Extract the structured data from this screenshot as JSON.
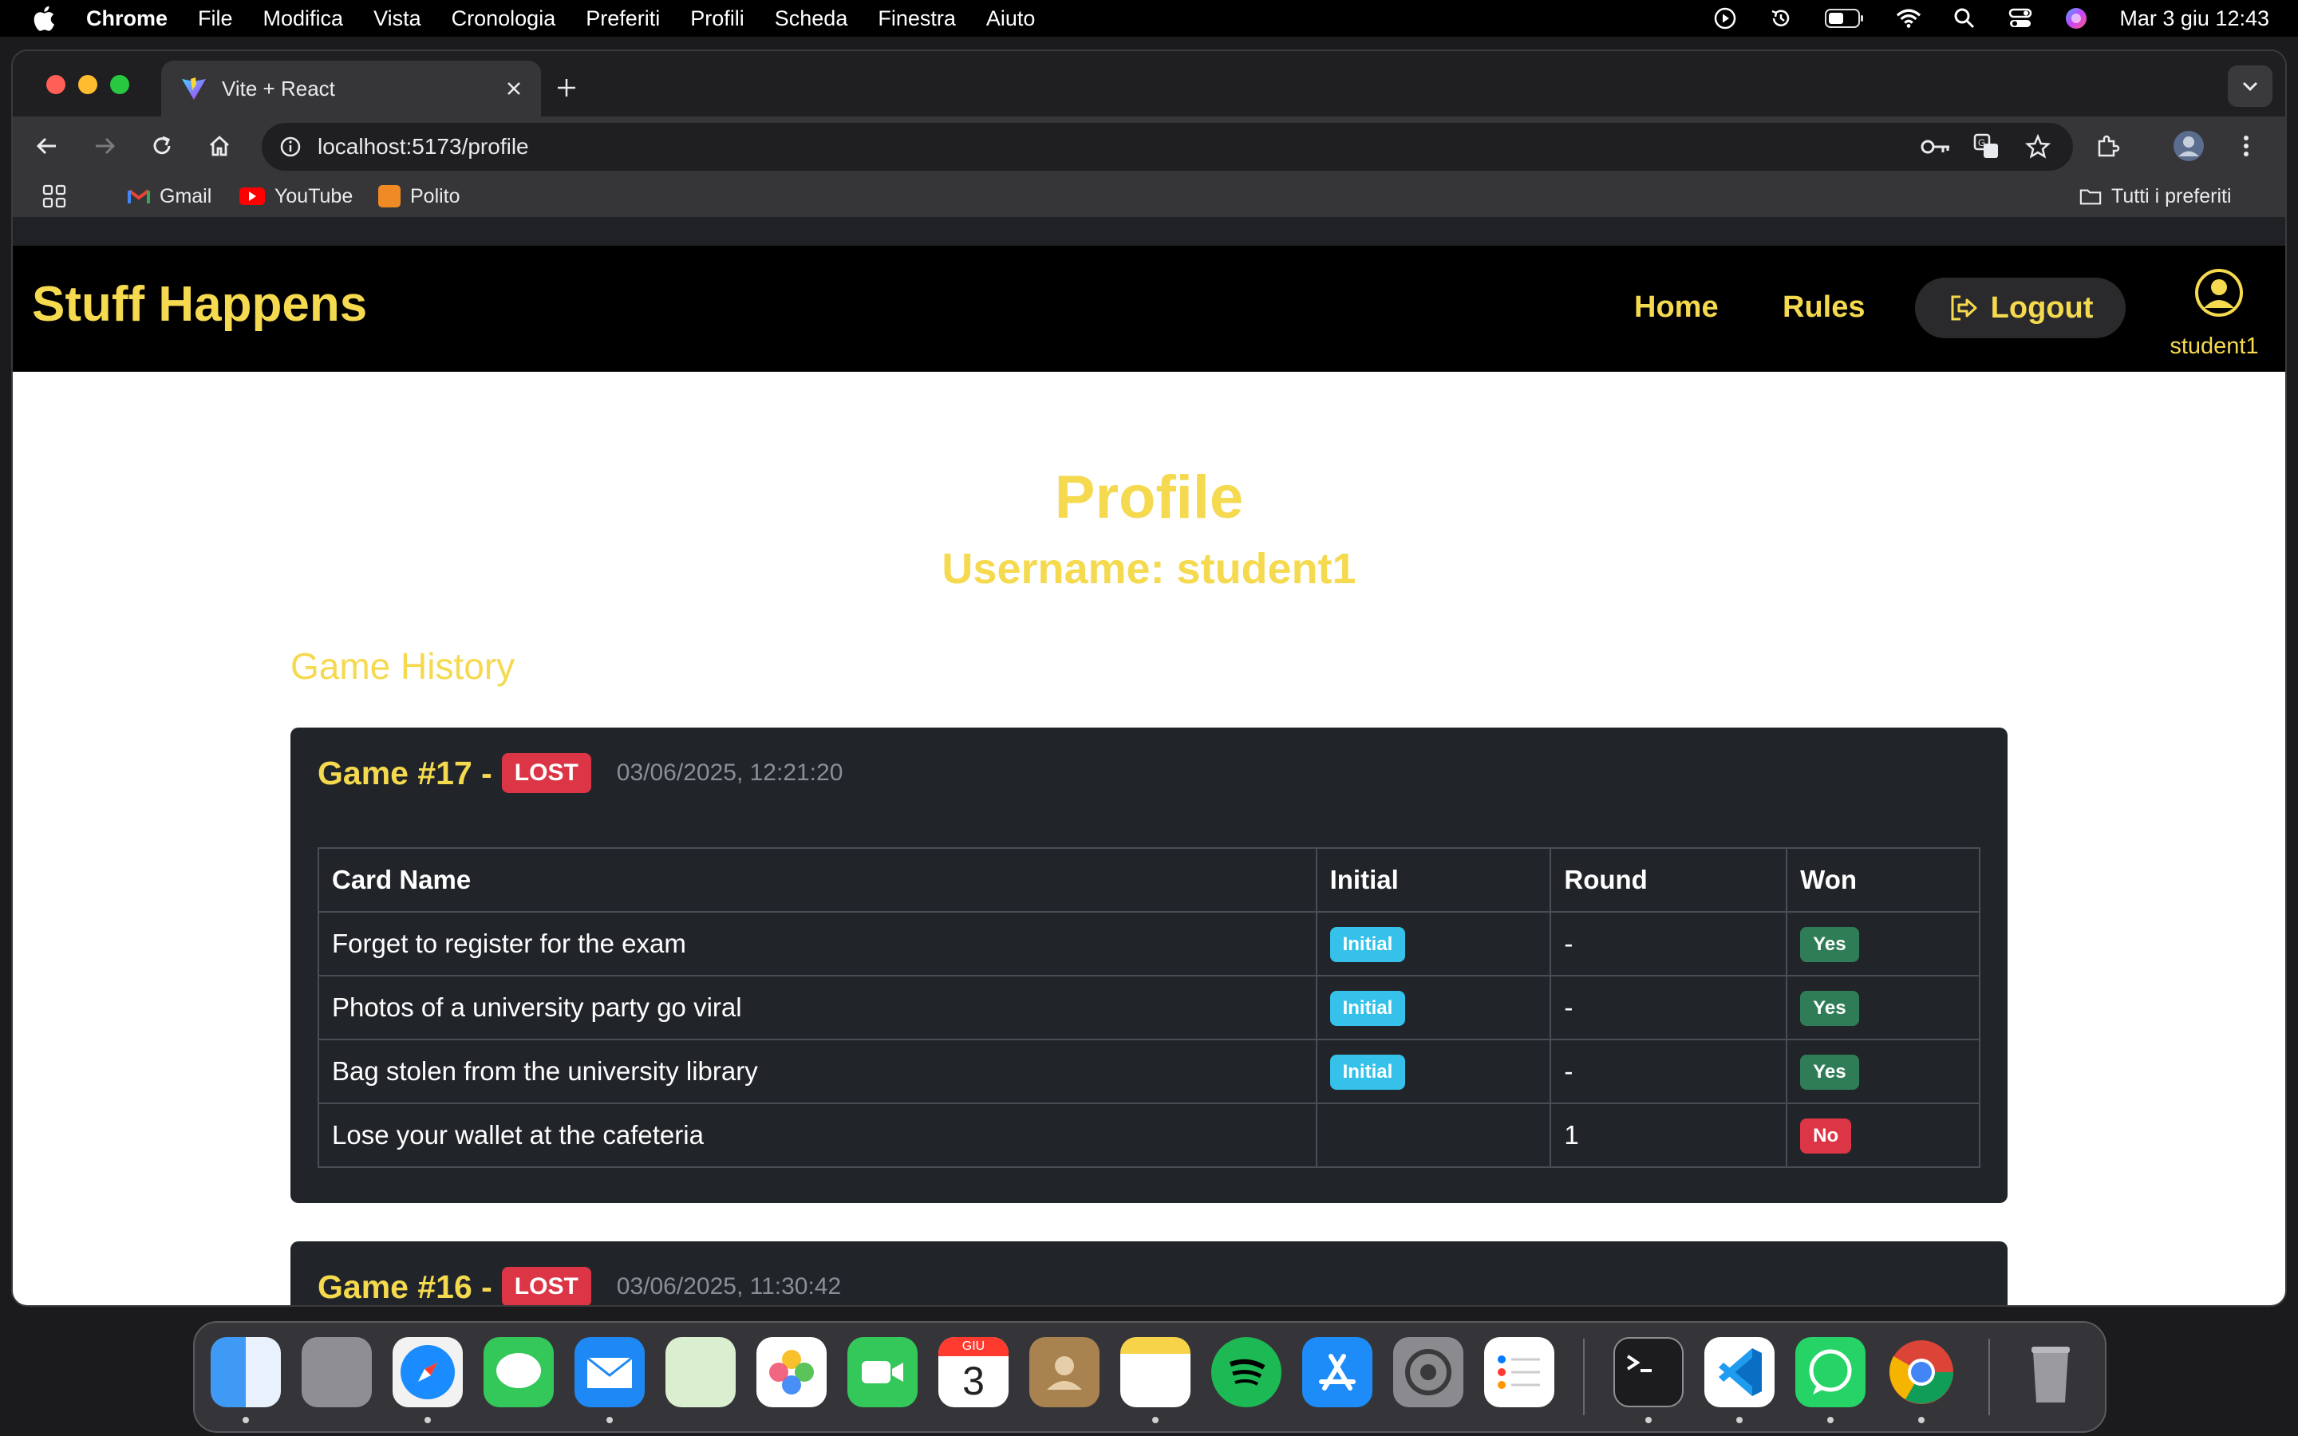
{
  "menubar": {
    "app_name": "Chrome",
    "menus": [
      "File",
      "Modifica",
      "Vista",
      "Cronologia",
      "Preferiti",
      "Profili",
      "Scheda",
      "Finestra",
      "Aiuto"
    ],
    "clock": "Mar 3 giu  12:43"
  },
  "browser": {
    "tab_title": "Vite + React",
    "url": "localhost:5173/profile",
    "bookmarks": [
      "Gmail",
      "YouTube",
      "Polito"
    ],
    "all_bookmarks": "Tutti i preferiti"
  },
  "app": {
    "brand": "Stuff Happens",
    "nav_home": "Home",
    "nav_rules": "Rules",
    "logout": "Logout",
    "user": "student1"
  },
  "profile": {
    "title": "Profile",
    "subtitle": "Username: student1",
    "section": "Game History"
  },
  "games": [
    {
      "title": "Game #17 -",
      "status": "LOST",
      "date": "03/06/2025, 12:21:20",
      "headers": [
        "Card Name",
        "Initial",
        "Round",
        "Won"
      ],
      "rows": [
        {
          "name": "Forget to register for the exam",
          "initial": "Initial",
          "round": "-",
          "won": "Yes"
        },
        {
          "name": "Photos of a university party go viral",
          "initial": "Initial",
          "round": "-",
          "won": "Yes"
        },
        {
          "name": "Bag stolen from the university library",
          "initial": "Initial",
          "round": "-",
          "won": "Yes"
        },
        {
          "name": "Lose your wallet at the cafeteria",
          "initial": "",
          "round": "1",
          "won": "No"
        }
      ]
    },
    {
      "title": "Game #16 -",
      "status": "LOST",
      "date": "03/06/2025, 11:30:42"
    }
  ],
  "dock": {
    "calendar_month": "GIU",
    "calendar_day": "3"
  },
  "colors": {
    "accent": "#f5d94e",
    "card_bg": "#212529",
    "badge_lost": "#dc3545",
    "badge_initial": "#35c1ea",
    "badge_yes": "#2f7d56"
  }
}
